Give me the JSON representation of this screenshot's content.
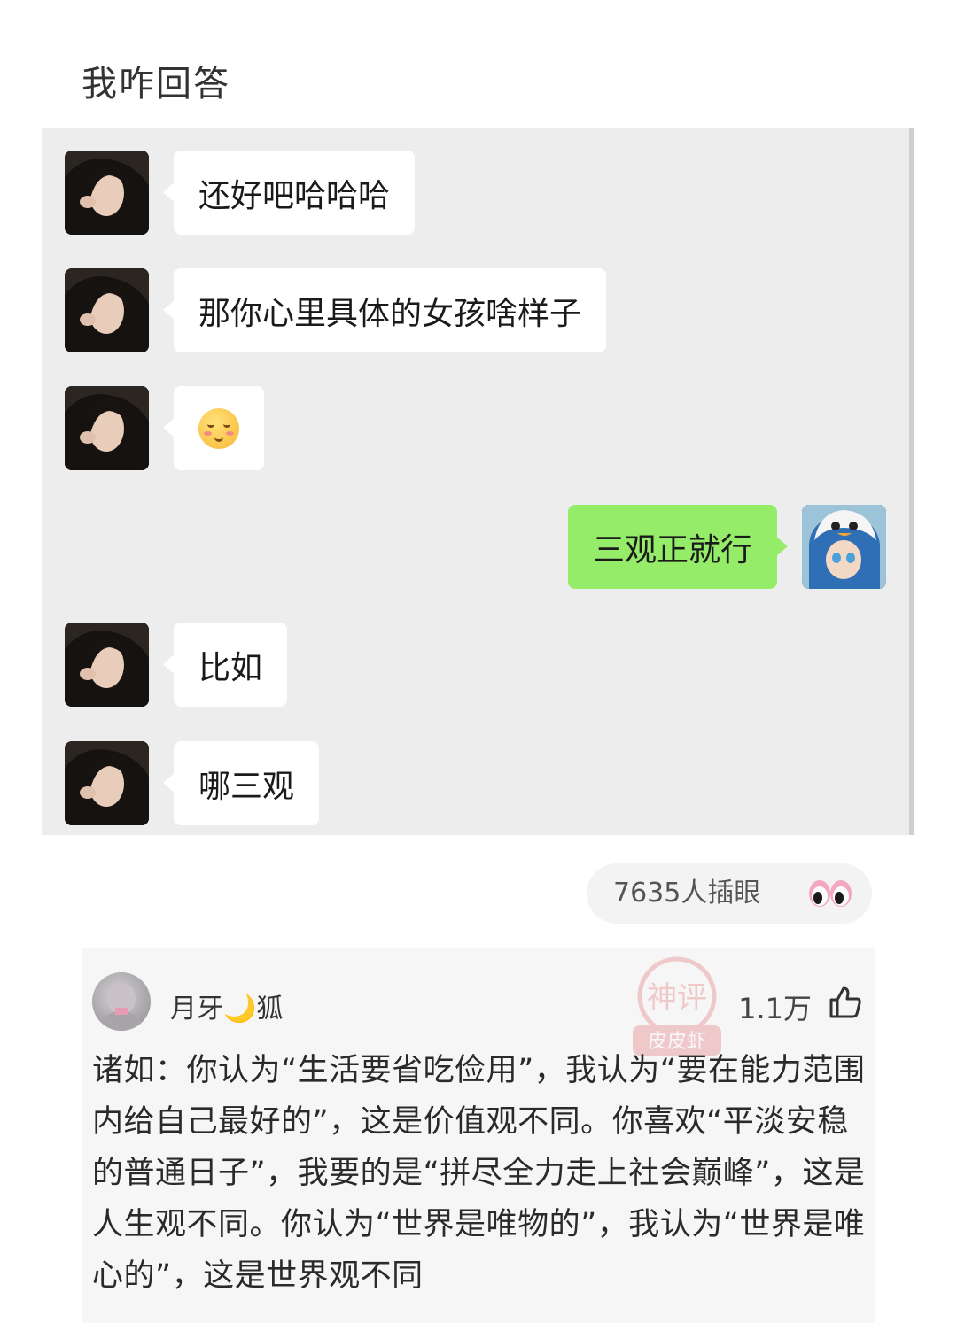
{
  "post": {
    "title": "我咋回答"
  },
  "chat": {
    "messages": [
      {
        "side": "left",
        "text": "还好吧哈哈哈"
      },
      {
        "side": "left",
        "text": "那你心里具体的女孩啥样子"
      },
      {
        "side": "left",
        "emoji": "smiling-face-with-blush-emoji"
      },
      {
        "side": "right",
        "text": "三观正就行"
      },
      {
        "side": "left",
        "text": "比如"
      },
      {
        "side": "left",
        "text": "哪三观"
      }
    ]
  },
  "views": {
    "label": "7635人插眼",
    "icon": "eyes-icon"
  },
  "comment": {
    "user_name": "月牙",
    "user_name_emoji": "🌙",
    "user_name_suffix": "狐",
    "likes": "1.1万",
    "like_icon": "thumbs-up-icon",
    "watermark_text": "神评",
    "watermark_sub": "皮皮虾",
    "text": "诸如：你认为“生活要省吃俭用”，我认为“要在能力范围内给自己最好的”，这是价值观不同。你喜欢“平淡安稳的普通日子”，我要的是“拼尽全力走上社会巅峰”，这是人生观不同。你认为“世界是唯物的”，我认为“世界是唯心的”，这是世界观不同"
  },
  "colors": {
    "chat_bg": "#ededed",
    "sent_bubble": "#95ec69",
    "received_bubble": "#ffffff",
    "comment_bg": "#f6f6f6"
  }
}
